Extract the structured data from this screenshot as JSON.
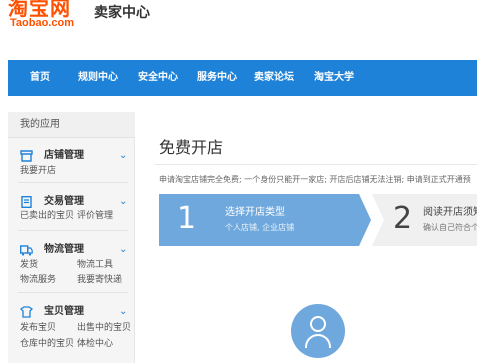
{
  "header": {
    "logo_cn": "淘宝网",
    "logo_en": "Taobao.com",
    "title": "卖家中心"
  },
  "nav": {
    "items": [
      "首页",
      "规则中心",
      "安全中心",
      "服务中心",
      "卖家论坛",
      "淘宝大学"
    ]
  },
  "sidebar": {
    "title": "我的应用",
    "groups": [
      {
        "label": "店铺管理",
        "icon": "store-icon",
        "links": [
          "我要开店"
        ]
      },
      {
        "label": "交易管理",
        "icon": "trade-icon",
        "links": [
          "已卖出的宝贝",
          "评价管理"
        ]
      },
      {
        "label": "物流管理",
        "icon": "logistics-icon",
        "links": [
          "发货",
          "物流工具",
          "物流服务",
          "我要寄快递"
        ]
      },
      {
        "label": "宝贝管理",
        "icon": "product-icon",
        "links": [
          "发布宝贝",
          "出售中的宝贝",
          "仓库中的宝贝",
          "体检中心"
        ]
      }
    ]
  },
  "main": {
    "title": "免费开店",
    "notice": "申请淘宝店铺完全免费; 一个身份只能开一家店; 开店后店铺无法注销; 申请到正式开通预",
    "steps": [
      {
        "num": "1",
        "title": "选择开店类型",
        "sub": "个人店铺, 企业店铺"
      },
      {
        "num": "2",
        "title": "阅读开店须知",
        "sub": "确认自己符合个"
      }
    ]
  },
  "colors": {
    "brand": "#ff5000",
    "nav": "#1f82d9",
    "step_active": "#6fa8dc"
  }
}
